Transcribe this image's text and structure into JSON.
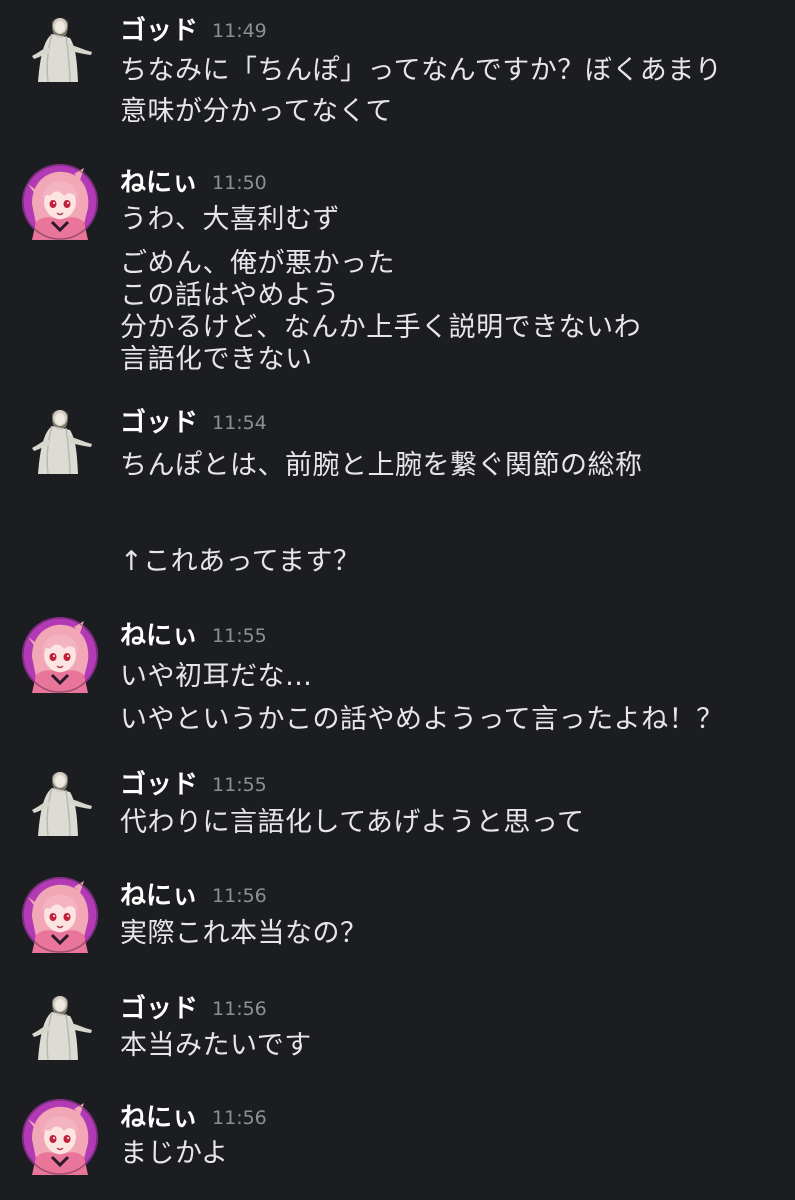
{
  "colors": {
    "background": "#1c1d21",
    "name": "#ffffff",
    "text": "#e6e6e9",
    "timestamp": "#8e8f96",
    "avatar_nenyi_bg": "#b23bb5"
  },
  "messages": [
    {
      "author": "ゴッド",
      "avatar_icon": "statue-avatar-icon",
      "time": "11:49",
      "lines": [
        "ちなみに「ちんぽ」ってなんですか？ぼくあまり",
        "意味が分かってなくて"
      ]
    },
    {
      "author": "ねにぃ",
      "avatar_icon": "anime-girl-avatar-icon",
      "time": "11:50",
      "lines": [
        "うわ、大喜利むず",
        "ごめん、俺が悪かった",
        "この話はやめよう",
        "分かるけど、なんか上手く説明できないわ",
        "言語化できない"
      ]
    },
    {
      "author": "ゴッド",
      "avatar_icon": "statue-avatar-icon",
      "time": "11:54",
      "lines": [
        "ちんぽとは、前腕と上腕を繋ぐ関節の総称",
        "",
        "↑これあってます？"
      ]
    },
    {
      "author": "ねにぃ",
      "avatar_icon": "anime-girl-avatar-icon",
      "time": "11:55",
      "lines": [
        "いや初耳だな…",
        "いやというかこの話やめようって言ったよね！？"
      ]
    },
    {
      "author": "ゴッド",
      "avatar_icon": "statue-avatar-icon",
      "time": "11:55",
      "lines": [
        "代わりに言語化してあげようと思って"
      ]
    },
    {
      "author": "ねにぃ",
      "avatar_icon": "anime-girl-avatar-icon",
      "time": "11:56",
      "lines": [
        "実際これ本当なの？"
      ]
    },
    {
      "author": "ゴッド",
      "avatar_icon": "statue-avatar-icon",
      "time": "11:56",
      "lines": [
        "本当みたいです"
      ]
    },
    {
      "author": "ねにぃ",
      "avatar_icon": "anime-girl-avatar-icon",
      "time": "11:56",
      "lines": [
        "まじかよ"
      ]
    }
  ]
}
